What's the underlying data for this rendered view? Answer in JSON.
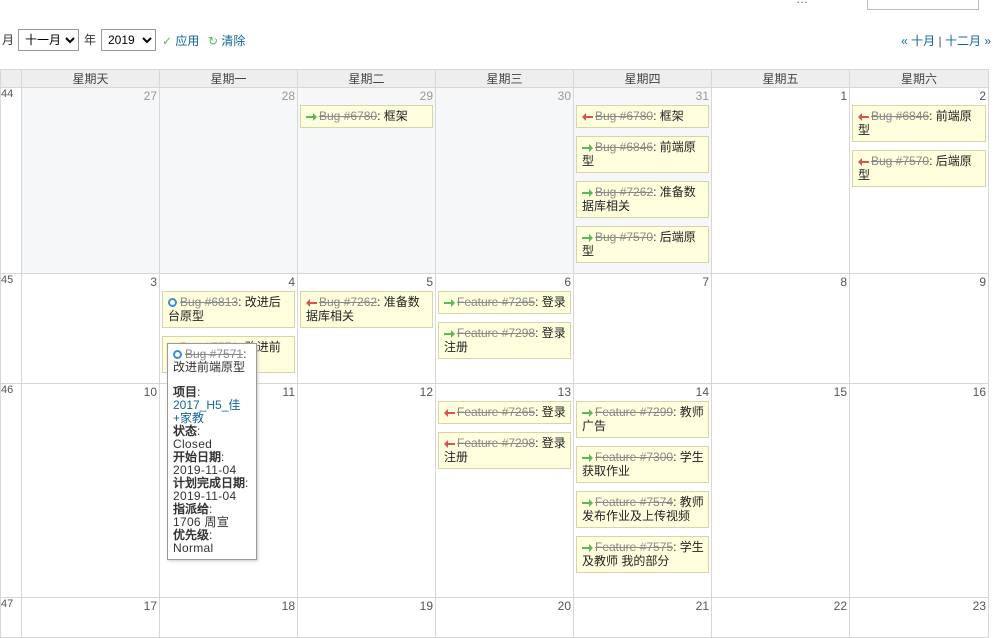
{
  "topbar": {
    "filter_label": "…",
    "month_suffix": "月",
    "month_value": "十一月",
    "year_label": "年",
    "year_value": "2019",
    "apply": "应用",
    "clear": "清除",
    "prev": "« 十月",
    "sep": "|",
    "next": "十二月 »"
  },
  "calendar": {
    "weekdays": [
      "星期天",
      "星期一",
      "星期二",
      "星期三",
      "星期四",
      "星期五",
      "星期六"
    ],
    "weeks": [
      {
        "num": "44",
        "days": [
          {
            "d": "27",
            "other": true,
            "issues": []
          },
          {
            "d": "28",
            "other": true,
            "issues": []
          },
          {
            "d": "29",
            "other": true,
            "issues": [
              {
                "icon": "start",
                "tracker": "Bug #6780",
                "subject": ": 框架"
              }
            ]
          },
          {
            "d": "30",
            "other": true,
            "issues": []
          },
          {
            "d": "31",
            "other": true,
            "issues": [
              {
                "icon": "end",
                "tracker": "Bug #6780",
                "subject": ": 框架"
              },
              {
                "icon": "start",
                "tracker": "Bug #6846",
                "subject": ": 前端原型"
              },
              {
                "icon": "start",
                "tracker": "Bug #7262",
                "subject": ": 准备数据库相关"
              },
              {
                "icon": "start",
                "tracker": "Bug #7570",
                "subject": ": 后端原型"
              }
            ]
          },
          {
            "d": "1",
            "other": false,
            "issues": []
          },
          {
            "d": "2",
            "other": false,
            "issues": [
              {
                "icon": "end",
                "tracker": "Bug #6846",
                "subject": ": 前端原型"
              },
              {
                "icon": "end",
                "tracker": "Bug #7570",
                "subject": ": 后端原型"
              }
            ]
          }
        ]
      },
      {
        "num": "45",
        "days": [
          {
            "d": "3",
            "other": false,
            "issues": []
          },
          {
            "d": "4",
            "other": false,
            "issues": [
              {
                "icon": "circle",
                "tracker": "Bug #6813",
                "subject": ": 改进后台原型"
              },
              {
                "icon": "circle",
                "tracker": "Bug #7571",
                "subject": ": 改进前端原型"
              }
            ]
          },
          {
            "d": "5",
            "other": false,
            "issues": [
              {
                "icon": "end",
                "tracker": "Bug #7262",
                "subject": ": 准备数据库相关"
              }
            ]
          },
          {
            "d": "6",
            "other": false,
            "issues": [
              {
                "icon": "start",
                "tracker": "Feature #7265",
                "subject": ": 登录"
              },
              {
                "icon": "start",
                "tracker": "Feature #7298",
                "subject": ": 登录注册"
              }
            ]
          },
          {
            "d": "7",
            "other": false,
            "issues": []
          },
          {
            "d": "8",
            "other": false,
            "issues": []
          },
          {
            "d": "9",
            "other": false,
            "issues": []
          }
        ]
      },
      {
        "num": "46",
        "days": [
          {
            "d": "10",
            "other": false,
            "issues": []
          },
          {
            "d": "11",
            "other": false,
            "issues": []
          },
          {
            "d": "12",
            "other": false,
            "issues": []
          },
          {
            "d": "13",
            "other": false,
            "issues": [
              {
                "icon": "end",
                "tracker": "Feature #7265",
                "subject": ": 登录"
              },
              {
                "icon": "end",
                "tracker": "Feature #7298",
                "subject": ": 登录注册"
              }
            ]
          },
          {
            "d": "14",
            "other": false,
            "issues": [
              {
                "icon": "start",
                "tracker": "Feature #7299",
                "subject": ": 教师 广告"
              },
              {
                "icon": "start",
                "tracker": "Feature #7300",
                "subject": ": 学生获取作业"
              },
              {
                "icon": "start",
                "tracker": "Feature #7574",
                "subject": ": 教师发布作业及上传视频"
              },
              {
                "icon": "start",
                "tracker": "Feature #7575",
                "subject": ": 学生及教师 我的部分"
              }
            ]
          },
          {
            "d": "15",
            "other": false,
            "issues": []
          },
          {
            "d": "16",
            "other": false,
            "issues": []
          }
        ]
      },
      {
        "num": "47",
        "days": [
          {
            "d": "17",
            "other": false,
            "issues": []
          },
          {
            "d": "18",
            "other": false,
            "issues": []
          },
          {
            "d": "19",
            "other": false,
            "issues": []
          },
          {
            "d": "20",
            "other": false,
            "issues": []
          },
          {
            "d": "21",
            "other": false,
            "issues": []
          },
          {
            "d": "22",
            "other": false,
            "issues": []
          },
          {
            "d": "23",
            "other": false,
            "issues": []
          }
        ]
      }
    ]
  },
  "tooltip": {
    "tracker": "Bug #7571",
    "subject": ": 改进前端原型",
    "project_label": "项目",
    "project_value": "2017_H5_佳+家教",
    "status_label": "状态",
    "status_value": "Closed",
    "start_label": "开始日期",
    "start_value": "2019-11-04",
    "due_label": "计划完成日期",
    "due_value": "2019-11-04",
    "assignee_label": "指派给",
    "assignee_value": "1706 周宣",
    "priority_label": "优先级",
    "priority_value": "Normal"
  },
  "colors": {
    "arrow_start": "#5cb85c",
    "arrow_end": "#d9534f",
    "status_icon": "#3b8fd6"
  }
}
